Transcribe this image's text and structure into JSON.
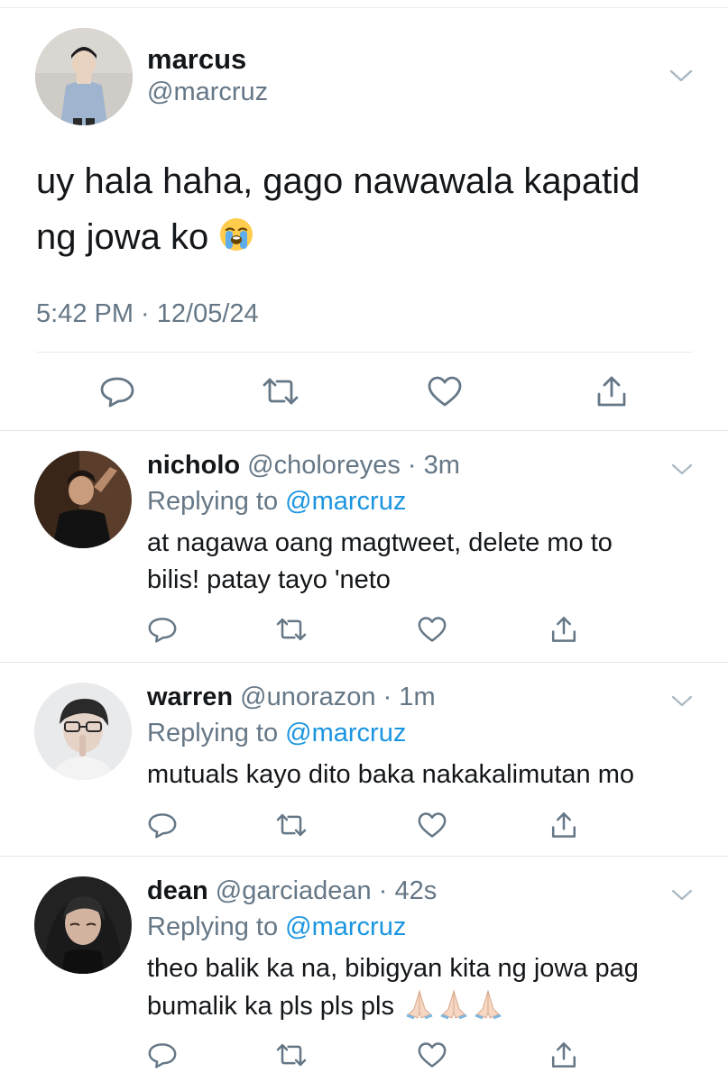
{
  "main_tweet": {
    "display_name": "marcus",
    "handle": "@marcruz",
    "text_line1": "uy hala haha, gago nawawala kapatid",
    "text_line2": "ng jowa ko",
    "emoji": "loudly-crying-face",
    "timestamp": "5:42 PM · 12/05/24",
    "actions": [
      "reply-icon",
      "retweet-icon",
      "like-icon",
      "share-icon"
    ]
  },
  "replies": [
    {
      "display_name": "nicholo",
      "handle_time": "@choloreyes · 3m",
      "replying_prefix": "Replying to",
      "replying_to": "@marcruz",
      "text_line1": "at nagawa oang magtweet, delete mo to",
      "text_line2": "bilis! patay tayo 'neto"
    },
    {
      "display_name": "warren",
      "handle_time": "@unorazon · 1m",
      "replying_prefix": "Replying to",
      "replying_to": "@marcruz",
      "text_line1": "mutuals kayo dito baka nakakalimutan mo",
      "text_line2": ""
    },
    {
      "display_name": "dean",
      "handle_time": "@garciadean · 42s",
      "replying_prefix": "Replying to",
      "replying_to": "@marcruz",
      "text_line1": "theo balik ka na, bibigyan kita ng jowa pag",
      "text_line2": "bumalik ka pls pls pls",
      "emoji": "folded-hands x3"
    }
  ],
  "colors": {
    "text": "#14171a",
    "secondary": "#657786",
    "mention": "#1b95e0",
    "divider": "#e6ecf0"
  }
}
